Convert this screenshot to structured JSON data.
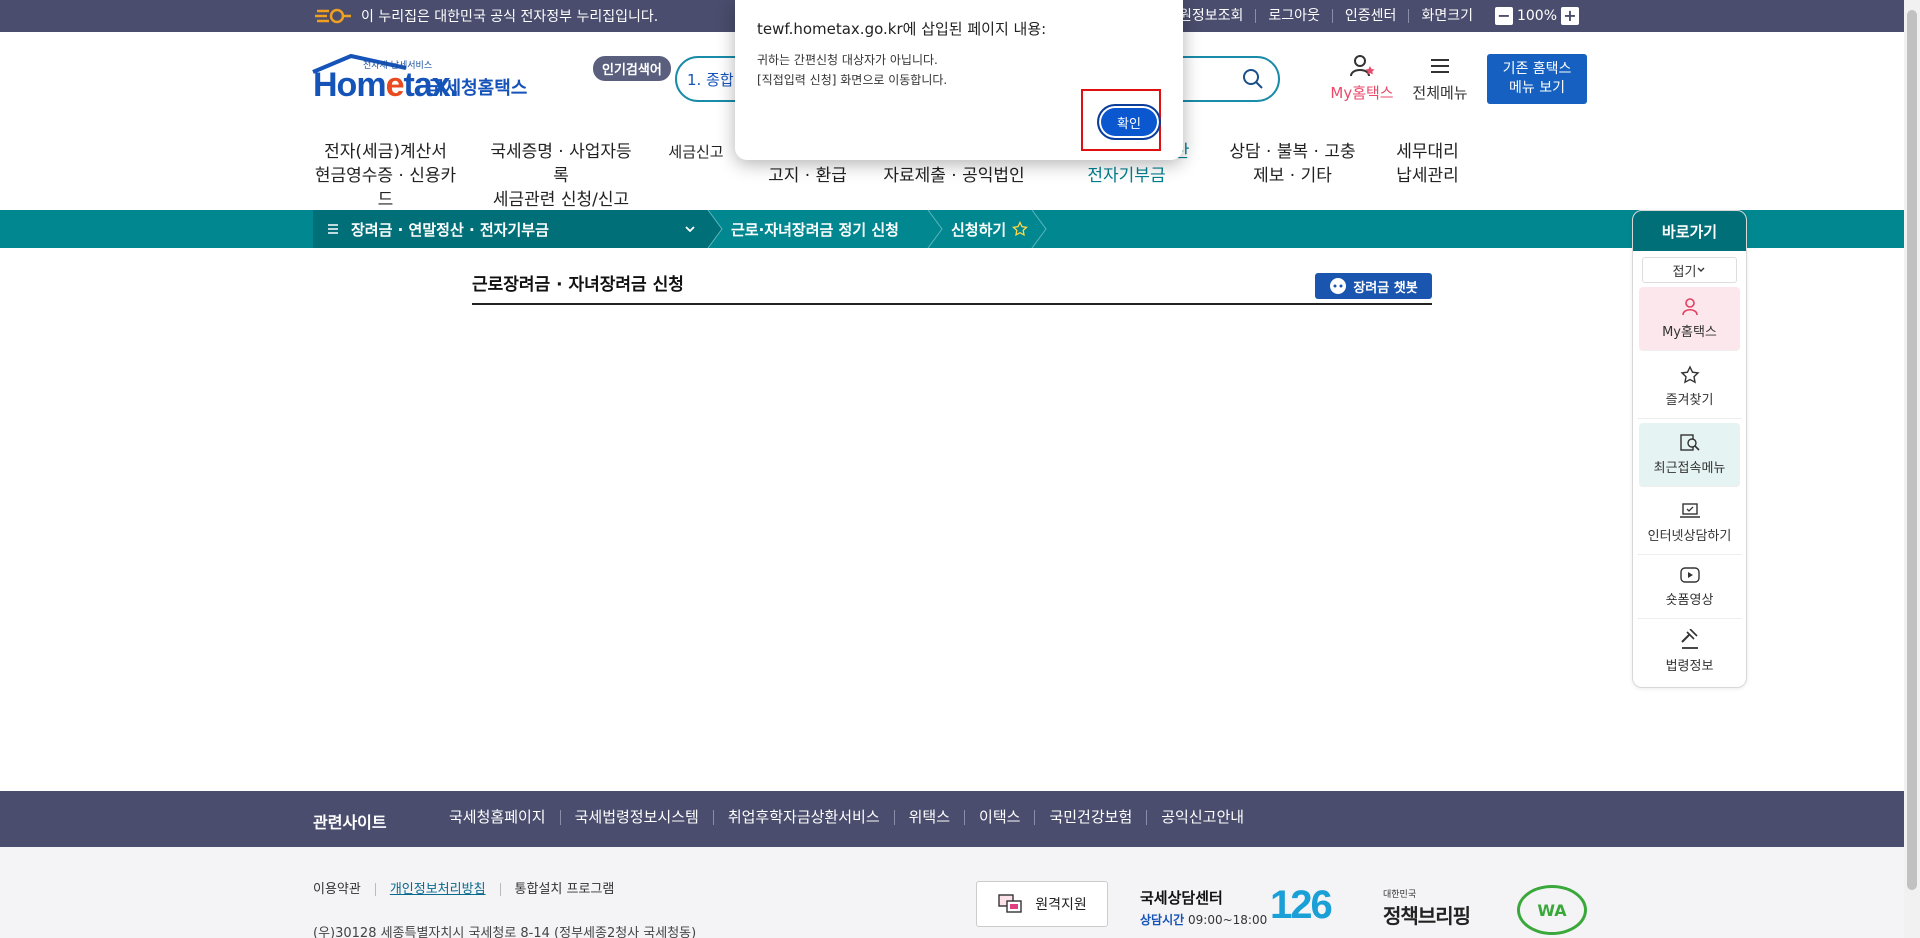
{
  "gov_bar": {
    "notice": "이 누리집은 대한민국 공식 전자정부 누리집입니다.",
    "links": [
      "회원정보조회",
      "로그아웃",
      "인증센터",
      "화면크기"
    ],
    "zoom_minus": "−",
    "zoom_level": "100%",
    "zoom_plus": "+"
  },
  "header": {
    "logo_tag": "전자세 납세서비스",
    "logo_word_a": "Hom",
    "logo_word_b": "e",
    "logo_word_c": "tax.",
    "logo_kor": "국세청홈택스",
    "popular_label": "인기검색어",
    "search_rank": "1.  종합",
    "my_hometax": "My홈택스",
    "all_menu": "전체메뉴",
    "old_hometax_l1": "기존 홈택스",
    "old_hometax_l2": "메뉴 보기"
  },
  "gnb": [
    {
      "l1": "전자(세금)계산서",
      "l2": "현금영수증 · 신용카드"
    },
    {
      "l1": "국세증명 · 사업자등록",
      "l2": "세금관련 신청/신고"
    },
    {
      "l1": "세금신고",
      "l2": ""
    },
    {
      "l1": "",
      "l2": "고지 · 환급"
    },
    {
      "l1": "",
      "l2": "자료제출 · 공익법인"
    },
    {
      "l1": "장려금 · 연말정산",
      "l2": "전자기부금"
    },
    {
      "l1": "상담 · 불복 · 고충",
      "l2": "제보 · 기타"
    },
    {
      "l1": "세무대리",
      "l2": "납세관리"
    }
  ],
  "breadcrumb": {
    "level1": "장려금 · 연말정산 · 전자기부금",
    "level2": "근로·자녀장려금 정기 신청",
    "level3": "신청하기"
  },
  "content": {
    "title": "근로장려금 · 자녀장려금 신청",
    "chatbot": "장려금 챗봇"
  },
  "quick_menu": {
    "title": "바로가기",
    "fold": "접기",
    "items": [
      "My홈택스",
      "즐겨찾기",
      "최근접속메뉴",
      "인터넷상담하기",
      "숏폼영상",
      "법령정보"
    ]
  },
  "footer": {
    "related_title": "관련사이트",
    "related_links": [
      "국세청홈페이지",
      "국세법령정보시스템",
      "취업후학자금상환서비스",
      "위택스",
      "이택스",
      "국민건강보험",
      "공익신고안내"
    ],
    "links": [
      "이용약관",
      "개인정보처리방침",
      "통합설치 프로그램"
    ],
    "address": "(우)30128 세종특별자치시 국세청로 8-14 (정부세종2청사 국세청동)",
    "remote": "원격지원",
    "call_center": "국세상담센터",
    "call_hours_label": "상담시간",
    "call_hours": "09:00~18:00",
    "call_number": "126",
    "brief_small": "대한민국",
    "brief_big": "정책브리핑",
    "wa": "WA"
  },
  "dialog": {
    "title": "tewf.hometax.go.kr에 삽입된 페이지 내용:",
    "line1": "귀하는 간편신청 대상자가 아닙니다.",
    "line2": "[직접입력 신청] 화면으로 이동합니다.",
    "ok": "확인"
  },
  "colors": {
    "gov_bar": "#4a4d6d",
    "teal": "#00878f",
    "teal_dark": "#006f78",
    "brand_blue": "#1553b8",
    "ok_blue": "#0b57d0",
    "highlight_red": "#e01010"
  }
}
